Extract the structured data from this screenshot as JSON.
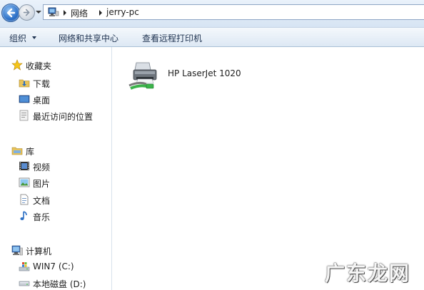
{
  "address_bar": {
    "back_icon": "back-arrow-icon",
    "forward_icon": "forward-arrow-icon",
    "location_icon": "network-icon",
    "breadcrumbs": [
      "网络",
      "jerry-pc"
    ]
  },
  "toolbar": {
    "organize_label": "组织",
    "network_center_label": "网络和共享中心",
    "view_printers_label": "查看远程打印机"
  },
  "sidebar": {
    "favorites": {
      "label": "收藏夹",
      "icon": "star-icon",
      "items": [
        {
          "label": "下载",
          "icon": "downloads-folder-icon"
        },
        {
          "label": "桌面",
          "icon": "desktop-icon"
        },
        {
          "label": "最近访问的位置",
          "icon": "recent-places-icon"
        }
      ]
    },
    "libraries": {
      "label": "库",
      "icon": "library-icon",
      "items": [
        {
          "label": "视频",
          "icon": "video-icon"
        },
        {
          "label": "图片",
          "icon": "pictures-icon"
        },
        {
          "label": "文档",
          "icon": "documents-icon"
        },
        {
          "label": "音乐",
          "icon": "music-icon"
        }
      ]
    },
    "computer": {
      "label": "计算机",
      "icon": "computer-icon",
      "items": [
        {
          "label": "WIN7 (C:)",
          "icon": "windows-drive-icon"
        },
        {
          "label": "本地磁盘 (D:)",
          "icon": "hard-drive-icon"
        }
      ]
    }
  },
  "content": {
    "printer_label": "HP LaserJet 1020",
    "printer_icon": "network-printer-icon"
  },
  "watermark": "广东龙网"
}
